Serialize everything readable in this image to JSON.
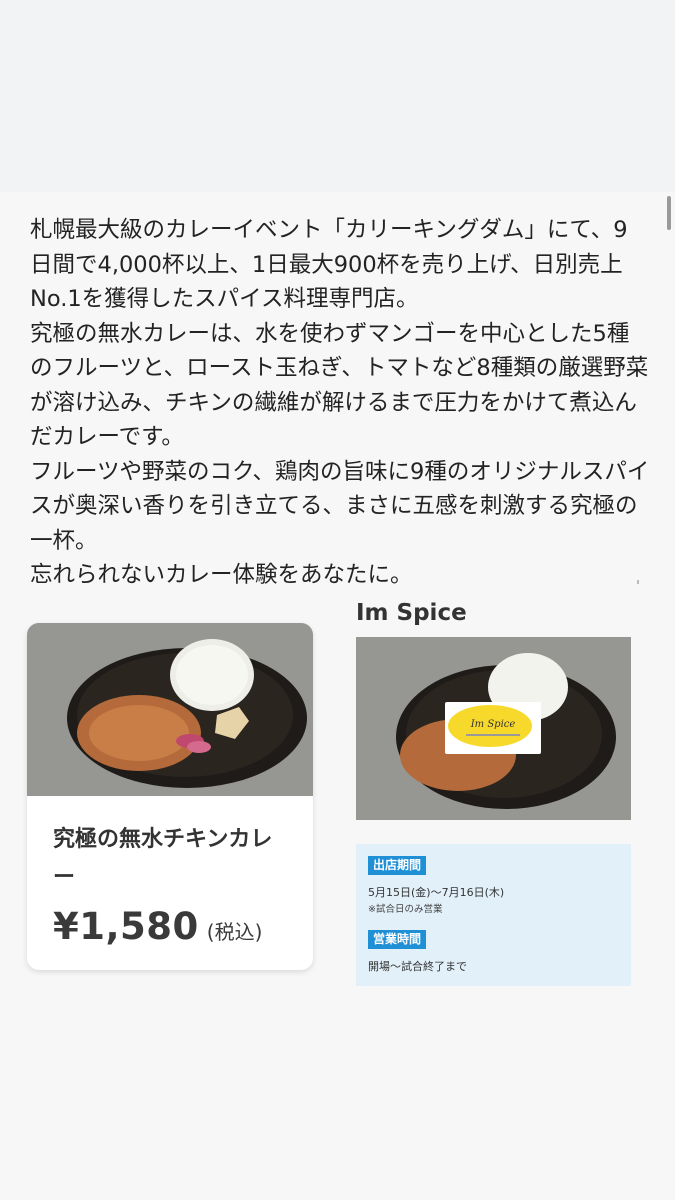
{
  "intro": {
    "lines": [
      "札幌最大級のカレーイベント「カリーキングダム」にて、9日間で4,000杯以上、1日最大900杯を売り上げ、日別売上No.1を獲得したスパイス料理専門店。",
      "究極の無水カレーは、水を使わずマンゴーを中心とした5種のフルーツと、ロースト玉ねぎ、トマトなど8種類の厳選野菜が溶け込み、チキンの繊維が解けるまで圧力をかけて煮込んだカレーです。",
      "フルーツや野菜のコク、鶏肉の旨味に9種のオリジナルスパイスが奥深い香りを引き立てる、まさに五感を刺激する究極の一杯。",
      "忘れられないカレー体験をあなたに。"
    ]
  },
  "product": {
    "name": "究極の無水チキンカレー",
    "price": "¥1,580",
    "tax_note": "(税込)"
  },
  "shop": {
    "name": "Im Spice",
    "logo_text": "Im Spice",
    "schedule_label": "出店期間",
    "schedule_value": "5月15日(金)〜7月16日(木)",
    "schedule_note": "※試合日のみ営業",
    "hours_label": "営業時間",
    "hours_value": "開場〜試合終了まで"
  },
  "colors": {
    "tag_blue": "#1f8fd6",
    "info_bg": "#e2f0fa",
    "logo_yellow": "#f7d92c"
  }
}
